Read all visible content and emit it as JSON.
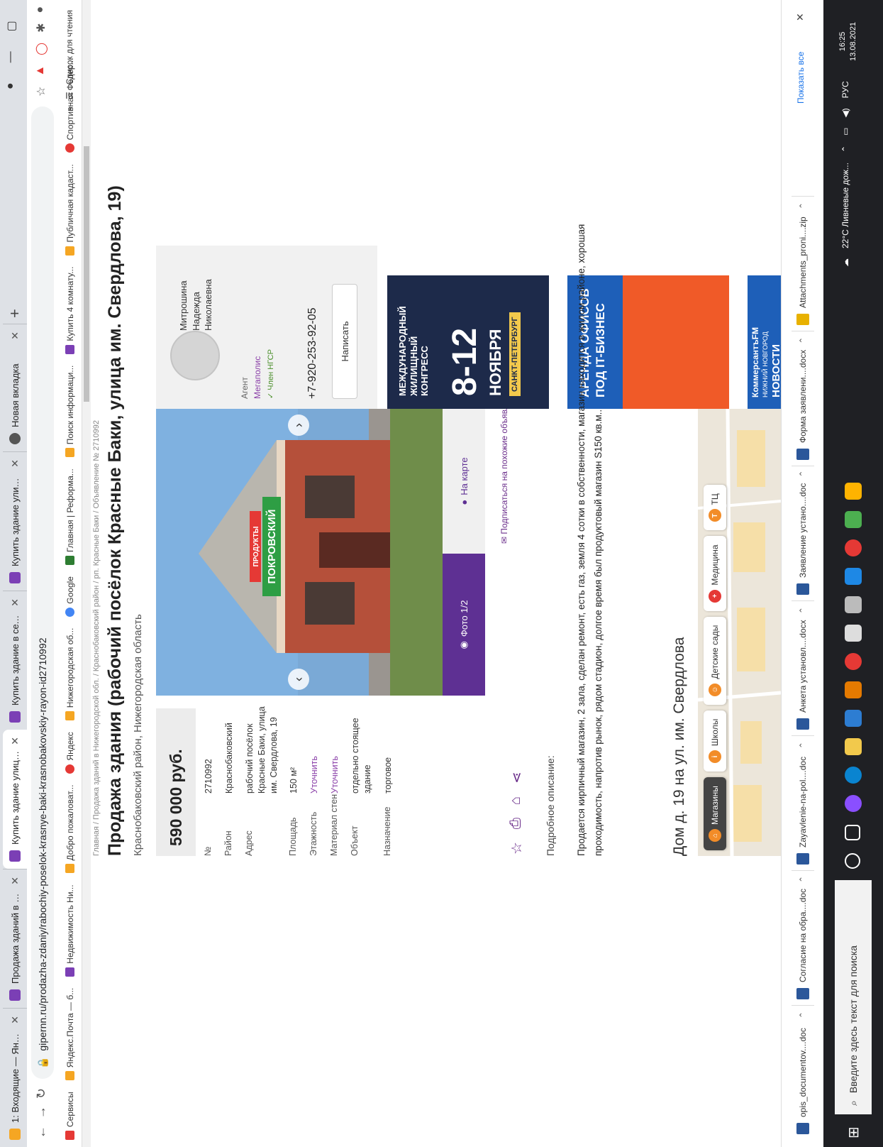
{
  "browser": {
    "tabs": [
      {
        "title": "1: Входящие — Яндекс.Почта",
        "color": "#f5a623"
      },
      {
        "title": "Продажа зданий в Нижегород",
        "color": "#7b3fb5"
      },
      {
        "title": "Купить здание улица им. Сверд",
        "color": "#7b3fb5"
      },
      {
        "title": "Купить здание в селе Великовс",
        "color": "#7b3fb5"
      },
      {
        "title": "Купить здание улица Соколова",
        "color": "#7b3fb5"
      },
      {
        "title": "Новая вкладка",
        "color": "#555555"
      }
    ],
    "url": "gipernn.ru/prodazha-zdaniy/rabochiy-poselok-krasnye-baki-krasnobakovskiy-rayon-id2710992",
    "bookmarks": [
      {
        "label": "Сервисы",
        "color": "#e53935"
      },
      {
        "label": "Яндекс.Почта — б...",
        "color": "#f5a623"
      },
      {
        "label": "Недвижимость Ни...",
        "color": "#7b3fb5"
      },
      {
        "label": "Добро пожаловат...",
        "color": "#f5a623"
      },
      {
        "label": "Яндекс",
        "color": "#e53935"
      },
      {
        "label": "Нижегородская об...",
        "color": "#f5a623"
      },
      {
        "label": "Google",
        "color": "#4285f4"
      },
      {
        "label": "Главная | Реформа...",
        "color": "#2e7d32"
      },
      {
        "label": "Поиск информаци...",
        "color": "#f5a623"
      },
      {
        "label": "Купить 4 комнату...",
        "color": "#7b3fb5"
      },
      {
        "label": "Публичная кадаст...",
        "color": "#f5a623"
      },
      {
        "label": "Спортивная Федер...",
        "color": "#e53935"
      }
    ],
    "reading_list": "Список для чтения",
    "bookmarks_more": "»"
  },
  "listing": {
    "breadcrumb": "Главная / Продажа зданий в Нижегородской обл. / Краснобаковский район / рп. Красные Баки / Объявление № 2710992",
    "title": "Продажа здания (рабочий посёлок Красные Баки, улица им. Свердлова, 19)",
    "subtitle": "Краснобаковский район, Нижегородская область",
    "price": "590 000 руб.",
    "props": [
      {
        "k": "№",
        "v": "2710992",
        "link": false
      },
      {
        "k": "Район",
        "v": "Краснобаковский",
        "link": false
      },
      {
        "k": "Адрес",
        "v": "рабочий посёлок Красные Баки, улица им. Свердлова, 19",
        "link": false
      },
      {
        "k": "Площадь",
        "v": "150 м²",
        "link": false
      },
      {
        "k": "Этажность",
        "v": "Уточнить",
        "link": true
      },
      {
        "k": "Материал стен",
        "v": "Уточнить",
        "link": true
      },
      {
        "k": "Объект",
        "v": "отдельно стоящее здание",
        "link": false
      },
      {
        "k": "Назначение",
        "v": "торговое",
        "link": false
      }
    ],
    "photo_label": "Фото 1/2",
    "map_button": "На карте",
    "subscribe": "Подписаться на похожие объявления",
    "shop_sign": "ПОКРОВСКИЙ",
    "shop_sign_top": "ПРОДУКТЫ",
    "desc_heading": "Подробное описание:",
    "description": "Продается кирпичный магазин, 2 зала, сделан ремонт, есть газ, земля 4 сотки в собственности, магазин находится в жилом районе, хорошая проходимость, напротив рынок, рядом стадион, долгое время был продуктовый магазин S150 кв.м..",
    "map_heading": "Дом д. 19 на ул. им. Свердлова",
    "map_chips": [
      {
        "label": "Магазины",
        "color": "#f28c28",
        "glyph": "⌂",
        "selected": true
      },
      {
        "label": "Школы",
        "color": "#f28c28",
        "glyph": "i",
        "selected": false
      },
      {
        "label": "Детские сады",
        "color": "#f28c28",
        "glyph": "☺",
        "selected": false
      },
      {
        "label": "Медицина",
        "color": "#e53935",
        "glyph": "+",
        "selected": false
      },
      {
        "label": "ТЦ",
        "color": "#f28c28",
        "glyph": "T",
        "selected": false
      }
    ]
  },
  "agent": {
    "name_line1": "Митрошина",
    "name_line2": "Надежда",
    "name_line3": "Николаевна",
    "role": "Агент",
    "company": "Мегаполис",
    "member": "✓ Член НГСР",
    "phone": "+7-920-253-92-05",
    "write": "Написать"
  },
  "ads": [
    {
      "l1": "МЕЖДУНАРОДНЫЙ",
      "l2": "ЖИЛИЩНЫЙ",
      "l3": "КОНГРЕСС",
      "date": "8-12",
      "month": "НОЯБРЯ",
      "city": "САНКТ-ПЕТЕРБУРГ",
      "bg": "#1d2a4a"
    },
    {
      "l1": "АРЕНДА ОФИСОВ",
      "l2": "ПОД IT-БИЗНЕС",
      "bg": "#1e5fb8",
      "accent": "#f05a28"
    },
    {
      "l1": "КоммерсантъFM",
      "l2": "НИЖНИЙ НОВГОРОД",
      "l3": "НОВОСТИ",
      "bg": "#1e5fb8"
    }
  ],
  "downloads": [
    "opis_documentov....doc",
    "Согласие на обра....doc",
    "Zayavlenie-na-pol....doc",
    "Анкета установл....docx",
    "Заявление устано....doc",
    "Форма заявлени....docx",
    "Attachments_proni....zip"
  ],
  "downloads_showall": "Показать все",
  "taskbar": {
    "search": "Введите здесь текст для поиска",
    "weather": "22°C  Ливневые дож...",
    "lang": "РУС",
    "time": "16:25",
    "date": "13.08.2021"
  }
}
